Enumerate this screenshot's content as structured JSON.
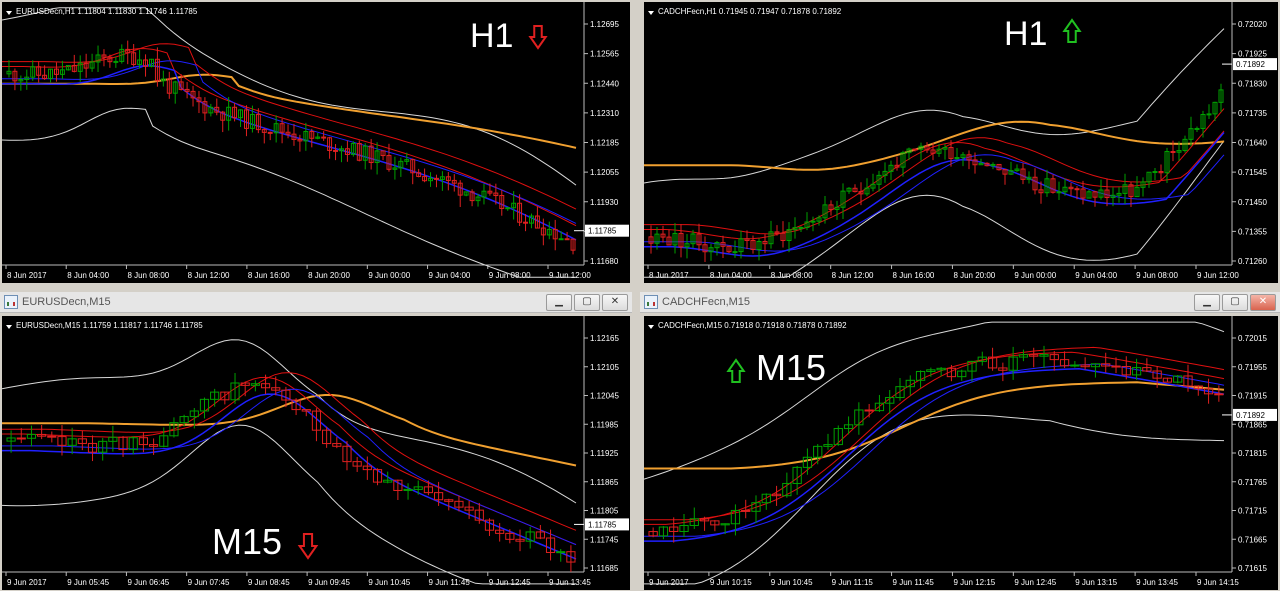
{
  "charts": {
    "eurusd_h1": {
      "header": "EURUSDecn,H1  1.11804 1.11830 1.11746 1.11785",
      "big_label": "H1",
      "arrow": "down",
      "price_labels": [
        "1.12695",
        "1.12565",
        "1.12440",
        "1.12310",
        "1.12185",
        "1.12055",
        "1.11930",
        "1.11805",
        "1.11680"
      ],
      "current_price": "1.11785",
      "time_labels": [
        "8 Jun 2017",
        "8 Jun 04:00",
        "8 Jun 08:00",
        "8 Jun 12:00",
        "8 Jun 16:00",
        "8 Jun 20:00",
        "9 Jun 00:00",
        "9 Jun 04:00",
        "9 Jun 08:00",
        "9 Jun 12:00"
      ]
    },
    "cadchf_h1": {
      "header": "CADCHFecn,H1  0.71945 0.71947 0.71878 0.71892",
      "big_label": "H1",
      "arrow": "up",
      "price_labels": [
        "0.72020",
        "0.71925",
        "0.71830",
        "0.71735",
        "0.71640",
        "0.71545",
        "0.71450",
        "0.71355",
        "0.71260"
      ],
      "current_price": "0.71892",
      "time_labels": [
        "8 Jun 2017",
        "8 Jun 04:00",
        "8 Jun 08:00",
        "8 Jun 12:00",
        "8 Jun 16:00",
        "8 Jun 20:00",
        "9 Jun 00:00",
        "9 Jun 04:00",
        "9 Jun 08:00",
        "9 Jun 12:00"
      ]
    },
    "eurusd_m15": {
      "window_title": "EURUSDecn,M15",
      "header": "EURUSDecn,M15  1.11759 1.11817 1.11746 1.11785",
      "big_label": "M15",
      "arrow": "down",
      "price_labels": [
        "1.12165",
        "1.12105",
        "1.12045",
        "1.11985",
        "1.11925",
        "1.11865",
        "1.11805",
        "1.11745",
        "1.11685"
      ],
      "current_price": "1.11785",
      "time_labels": [
        "9 Jun 2017",
        "9 Jun 05:45",
        "9 Jun 06:45",
        "9 Jun 07:45",
        "9 Jun 08:45",
        "9 Jun 09:45",
        "9 Jun 10:45",
        "9 Jun 11:45",
        "9 Jun 12:45",
        "9 Jun 13:45"
      ]
    },
    "cadchf_m15": {
      "window_title": "CADCHFecn,M15",
      "header": "CADCHFecn,M15  0.71918 0.71918 0.71878 0.71892",
      "big_label": "M15",
      "arrow": "up",
      "price_labels": [
        "0.72015",
        "0.71955",
        "0.71915",
        "0.71865",
        "0.71815",
        "0.71765",
        "0.71715",
        "0.71665",
        "0.71615"
      ],
      "current_price": "0.71892",
      "time_labels": [
        "9 Jun 2017",
        "9 Jun 10:15",
        "9 Jun 10:45",
        "9 Jun 11:15",
        "9 Jun 11:45",
        "9 Jun 12:15",
        "9 Jun 12:45",
        "9 Jun 13:15",
        "9 Jun 13:45",
        "9 Jun 14:15"
      ]
    }
  },
  "window_buttons": {
    "minimize": "▁",
    "maximize": "▢",
    "close": "✕"
  },
  "colors": {
    "bull": "#00a000",
    "bear": "#e02020",
    "ma_red": "#e01010",
    "ma_blue": "#2020ff",
    "ma_orange": "#f0a030",
    "bands": "#d8d8d8",
    "arrow_down": "#e02020",
    "arrow_up": "#20c020"
  }
}
